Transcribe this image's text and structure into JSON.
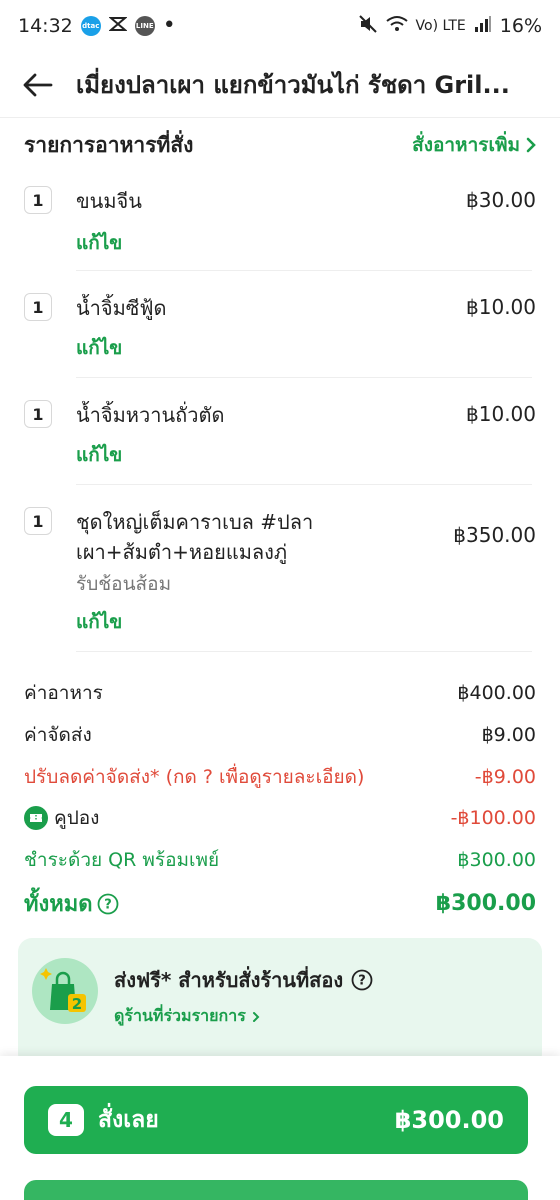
{
  "status_bar": {
    "time": "14:32",
    "app_dtac": "dtac",
    "app_line": "LINE",
    "volte": "Vo) LTE",
    "battery": "16%"
  },
  "header": {
    "title": "เมี่ยงปลาเผา แยกข้าวมันไก่ รัชดา  Gril..."
  },
  "order_section": {
    "title": "รายการอาหารที่สั่ง",
    "add_more": "สั่งอาหารเพิ่ม"
  },
  "items": [
    {
      "qty": "1",
      "name": "ขนมจีน",
      "price": "฿30.00",
      "note": "",
      "edit": "แก้ไข"
    },
    {
      "qty": "1",
      "name": "น้ำจิ้มซีฟู้ด",
      "price": "฿10.00",
      "note": "",
      "edit": "แก้ไข"
    },
    {
      "qty": "1",
      "name": "น้ำจิ้มหวานถั่วตัด",
      "price": "฿10.00",
      "note": "",
      "edit": "แก้ไข"
    },
    {
      "qty": "1",
      "name_line1": "ชุดใหญ่เต็มคาราเบล #ปลา",
      "name_line2": "เผา+ส้มตำ+หอยแมลงภู่",
      "price": "฿350.00",
      "note": "รับช้อนส้อม",
      "edit": "แก้ไข"
    }
  ],
  "summary": {
    "food_label": "ค่าอาหาร",
    "food_value": "฿400.00",
    "delivery_label": "ค่าจัดส่ง",
    "delivery_value": "฿9.00",
    "discount_label": "ปรับลดค่าจัดส่ง* (กด ? เพื่อดูรายละเอียด)",
    "discount_value": "-฿9.00",
    "coupon_label": "คูปอง",
    "coupon_value": "-฿100.00",
    "payment_label": "ชำระด้วย QR พร้อมเพย์",
    "payment_value": "฿300.00",
    "total_label": "ทั้งหมด",
    "total_value": "฿300.00"
  },
  "promo": {
    "title": "ส่งฟรี* สำหรับสั่งร้านที่สอง",
    "link": "ดูร้านที่ร่วมรายการ",
    "badge_number": "2"
  },
  "order_button": {
    "count": "4",
    "label": "สั่งเลย",
    "total": "฿300.00"
  },
  "colors": {
    "accent_green": "#1a9e4b",
    "button_green": "#1fae51",
    "discount_red": "#e04a3a",
    "promo_bg": "#e8f7ee"
  }
}
